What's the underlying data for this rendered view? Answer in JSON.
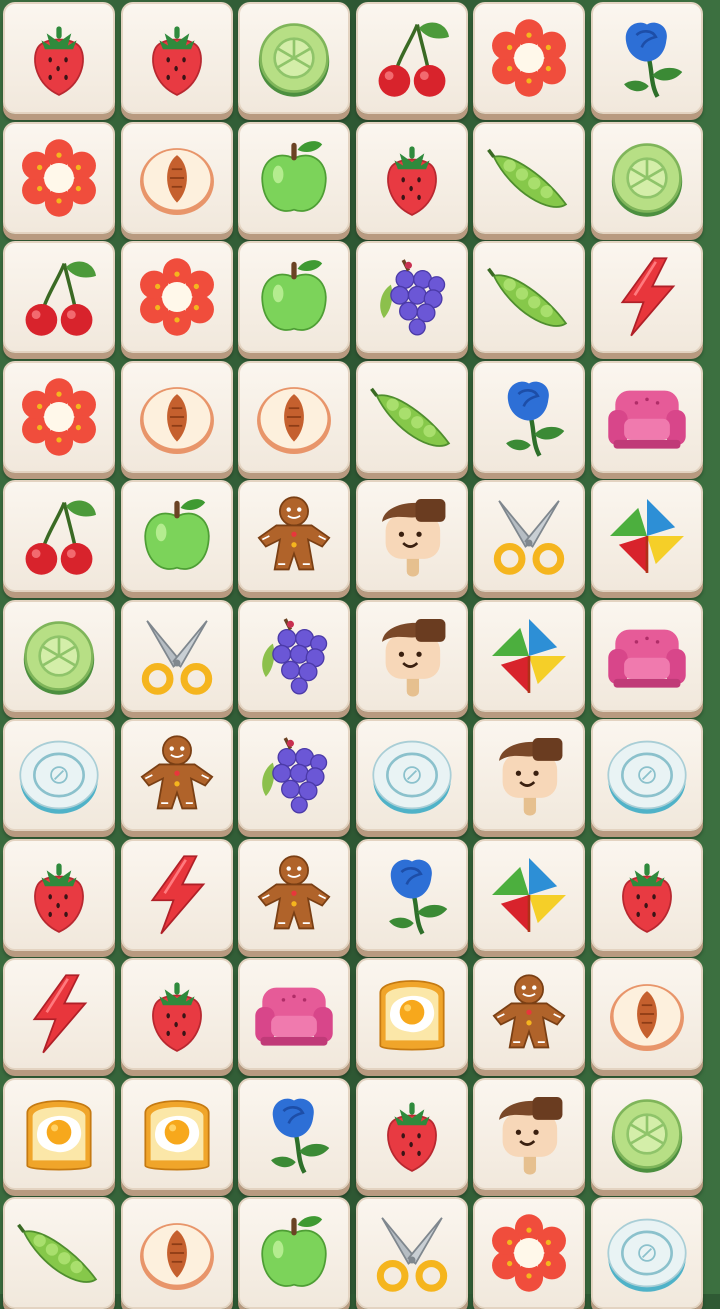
{
  "game": {
    "title": "",
    "columns": 6,
    "rows": [
      [
        "strawberry",
        "strawberry",
        "cucumber",
        "cherry",
        "red-flower",
        "blue-rose"
      ],
      [
        "red-flower",
        "peach",
        "green-apple",
        "strawberry",
        "pea-pod",
        "cucumber"
      ],
      [
        "cherry",
        "red-flower",
        "green-apple",
        "grapes",
        "pea-pod",
        "lightning"
      ],
      [
        "red-flower",
        "peach",
        "peach",
        "pea-pod",
        "blue-rose",
        "pink-armchair"
      ],
      [
        "cherry",
        "green-apple",
        "gingerbread",
        "popsicle-face",
        "scissors",
        "pinwheel"
      ],
      [
        "cucumber",
        "scissors",
        "grapes",
        "popsicle-face",
        "pinwheel",
        "pink-armchair"
      ],
      [
        "plate",
        "gingerbread",
        "grapes",
        "plate",
        "popsicle-face",
        "plate"
      ],
      [
        "strawberry",
        "lightning",
        "gingerbread",
        "blue-rose",
        "pinwheel",
        "strawberry"
      ],
      [
        "lightning",
        "strawberry",
        "pink-armchair",
        "egg-toast",
        "gingerbread",
        "peach"
      ],
      [
        "egg-toast",
        "egg-toast",
        "blue-rose",
        "strawberry",
        "popsicle-face",
        "cucumber"
      ],
      [
        "pea-pod",
        "peach",
        "green-apple",
        "scissors",
        "red-flower",
        "plate"
      ]
    ]
  },
  "colors": {
    "board_bg": "#2f5a34",
    "tile_face": "#f7f0e6",
    "tile_edge": "#b89a80"
  }
}
